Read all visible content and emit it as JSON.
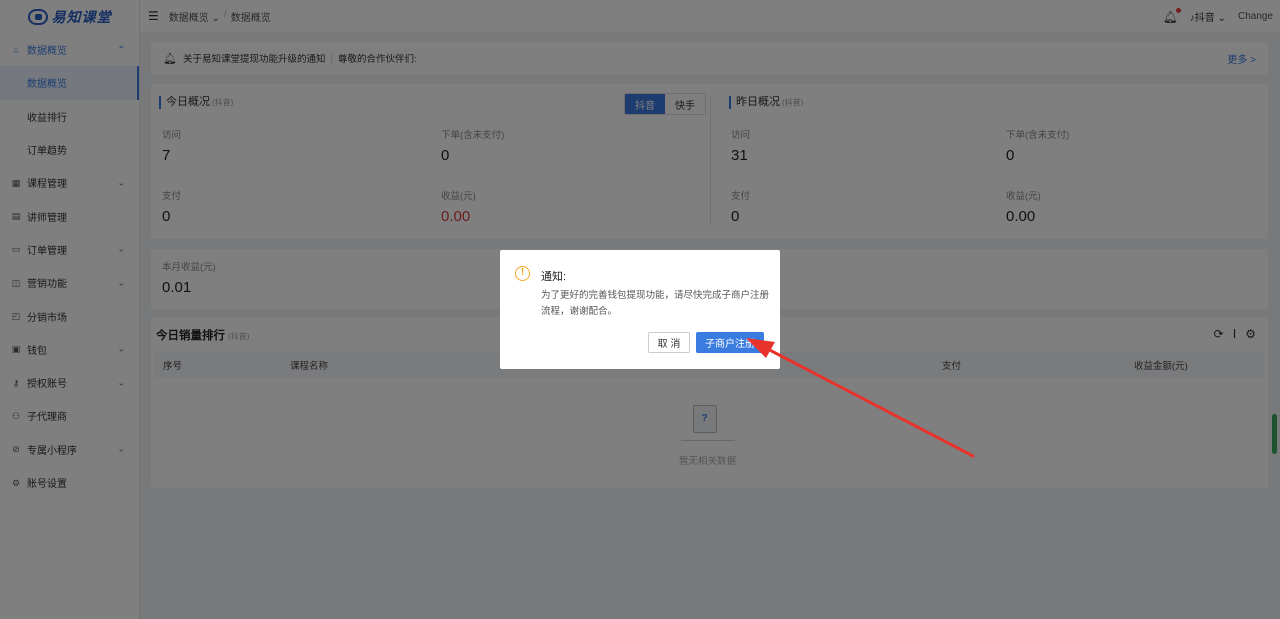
{
  "app": {
    "brand": "易知课堂"
  },
  "sidebar": {
    "items": [
      {
        "label": "数据概览",
        "icon": "home-icon",
        "chevron": "⌃",
        "open": true
      },
      {
        "label": "课程管理",
        "icon": "grid-icon",
        "chevron": "⌄"
      },
      {
        "label": "讲师管理",
        "icon": "id-card-icon",
        "chevron": ""
      },
      {
        "label": "订单管理",
        "icon": "monitor-icon",
        "chevron": "⌄"
      },
      {
        "label": "营销功能",
        "icon": "bag-icon",
        "chevron": "⌄"
      },
      {
        "label": "分销市场",
        "icon": "shop-icon",
        "chevron": ""
      },
      {
        "label": "钱包",
        "icon": "wallet-icon",
        "chevron": "⌄"
      },
      {
        "label": "授权账号",
        "icon": "key-icon",
        "chevron": "⌄"
      },
      {
        "label": "子代理商",
        "icon": "agent-icon",
        "chevron": ""
      },
      {
        "label": "专属小程序",
        "icon": "compass-icon",
        "chevron": "⌄"
      },
      {
        "label": "账号设置",
        "icon": "gear-icon",
        "chevron": ""
      }
    ],
    "sub_items": [
      "数据概览",
      "收益排行",
      "订单趋势"
    ]
  },
  "header": {
    "breadcrumb": [
      "数据概览 ⌄",
      "/",
      "数据概览"
    ],
    "platform": "抖音 ⌄",
    "change": "Change"
  },
  "notice": {
    "title": "关于易知课堂提现功能升级的通知",
    "text": "尊敬的合作伙伴们:",
    "more": "更多 >"
  },
  "today": {
    "title": "今日概况",
    "tag": "(抖音)",
    "tabs": [
      "抖音",
      "快手"
    ],
    "stats": [
      {
        "label": "访问",
        "value": "7"
      },
      {
        "label": "下单(含未支付)",
        "value": "0"
      },
      {
        "label": "支付",
        "value": "0"
      },
      {
        "label": "收益(元)",
        "value": "0.00"
      }
    ]
  },
  "yesterday": {
    "title": "昨日概况",
    "tag": "(抖音)",
    "stats": [
      {
        "label": "访问",
        "value": "31"
      },
      {
        "label": "下单(含未支付)",
        "value": "0"
      },
      {
        "label": "支付",
        "value": "0"
      },
      {
        "label": "收益(元)",
        "value": "0.00"
      }
    ]
  },
  "month": {
    "label": "本月收益(元)",
    "value": "0.01"
  },
  "ranking": {
    "title": "今日销量排行",
    "tag": "(抖音)",
    "columns": [
      "序号",
      "课程名称",
      "支付",
      "收益金额(元)"
    ],
    "empty_text": "暂无相关数据"
  },
  "modal": {
    "title": "通知:",
    "body": "为了更好的完善钱包提现功能，请尽快完成子商户注册流程，谢谢配合。",
    "cancel": "取 消",
    "confirm": "子商户注册"
  },
  "colors": {
    "accent": "#3a7be0",
    "warning": "#f5a623",
    "red": "#d9383b",
    "arrow": "#e8332d"
  }
}
